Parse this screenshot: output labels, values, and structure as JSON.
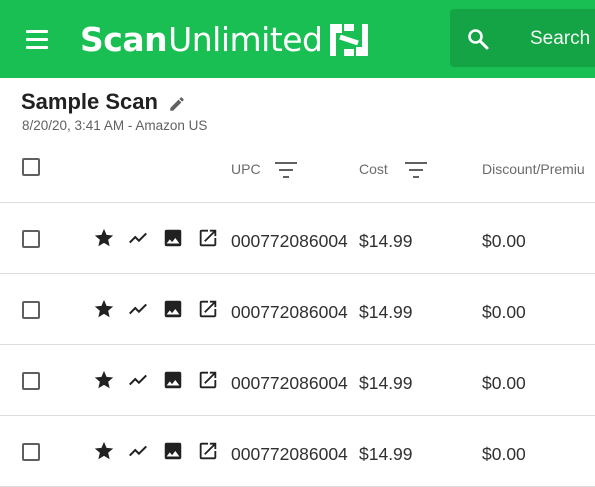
{
  "app": {
    "brand_bold": "Scan",
    "brand_light": "Unlimited",
    "search_placeholder": "Search",
    "accent": "#19bf52"
  },
  "scan": {
    "title": "Sample Scan",
    "subtitle": "8/20/20, 3:41 AM - Amazon US"
  },
  "table": {
    "columns": [
      "UPC",
      "Cost",
      "Discount/Premiu"
    ],
    "rows": [
      {
        "upc": "000772086004",
        "cost": "$14.99",
        "discount": "$0.00"
      },
      {
        "upc": "000772086004",
        "cost": "$14.99",
        "discount": "$0.00"
      },
      {
        "upc": "000772086004",
        "cost": "$14.99",
        "discount": "$0.00"
      },
      {
        "upc": "000772086004",
        "cost": "$14.99",
        "discount": "$0.00"
      }
    ],
    "row_icons": [
      "star-icon",
      "trend-icon",
      "image-icon",
      "open-external-icon"
    ]
  }
}
